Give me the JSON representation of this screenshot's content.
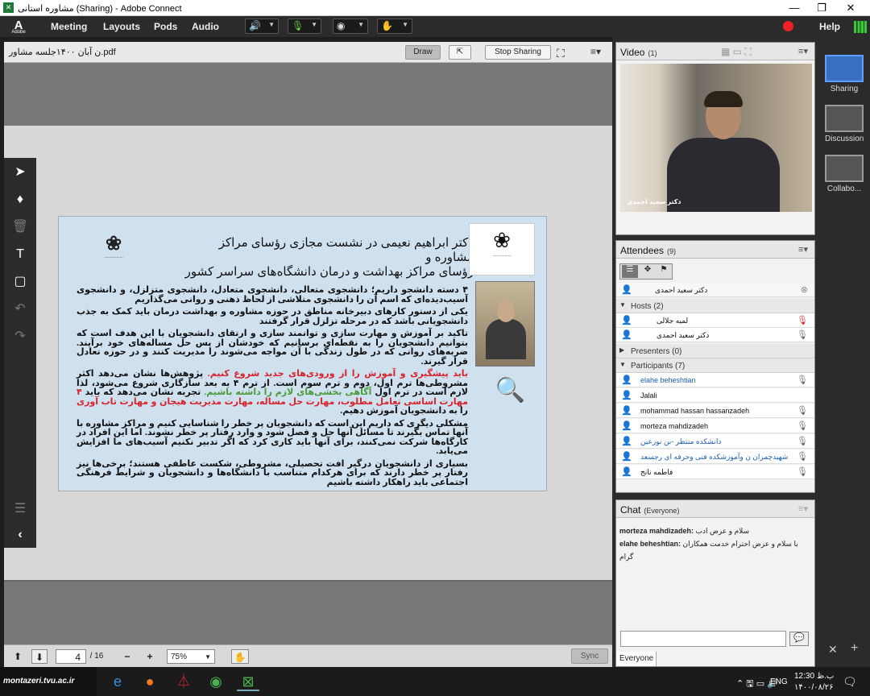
{
  "window": {
    "title": "مشاوره استانی (Sharing) - Adobe Connect",
    "minimize": "—",
    "maximize": "❐",
    "close": "✕"
  },
  "menubar": {
    "logo": "A",
    "logo_sub": "Adobe",
    "items": [
      "Meeting",
      "Layouts",
      "Pods",
      "Audio"
    ],
    "help": "Help"
  },
  "share": {
    "filename": "ن آبان ۱۴۰۰جلسه مشاور.pdf",
    "draw": "Draw",
    "stop": "Stop Sharing",
    "page_current": "4",
    "page_total": "/ 16",
    "zoom": "75%",
    "sync": "Sync"
  },
  "slide": {
    "heading_line1": "دکتر ابراهیم نعیمی در نشست مجازی رؤسای مراکز مشاوره و",
    "heading_line2": "رؤسای مراکز بهداشت و درمان دانشگاه‌های سراسر کشور",
    "p1": "۴ دسته دانشجو داریم؛ دانشجوی متعالی، دانشجوی متعادل، دانشجوی متزلزل، و دانشجوی آسیب‌دیده‌ای که اسم آن را دانشجوی متلاشی از لحاظ ذهنی و روانی می‌گذاریم",
    "p2": "یکی از دستور کارهای دبیرخانه مناطق در حوزه مشاوره و بهداشت درمان باید کمک به جذب دانشجویانی باشد که در مرحله تزلزل قرار گرفتند",
    "p3": "تاکید بر آموزش و مهارت سازی و توانمند سازی و ارتقای دانشجویان با این هدف است که بتوانیم دانشجویان را به نقطه‌ای برسانیم که خودشان از پس حل مساله‌های خود برآیند. ضربه‌های روانی که در طول زندگی با آن مواجه می‌شوند را مدیریت کنند و در حوزه تعادل قرار گیرند.",
    "p4_red": "باید پیشگیری و آموزش را از ورودی‌های جدید شروع کنیم.",
    "p4_a": " پژوهش‌ها نشان می‌دهد اکثر مشروطی‌ها ترم اول، دوم و ترم سوم است. از ترم ۴ به بعد سازگاری شروع می‌شود، لذا لازم است در ترم اول ",
    "p4_green": "آگاهی بخشی‌های لازم را داشته باشیم.",
    "p4_b": " تجربه نشان می‌دهد که باید ",
    "p4_red2": "۴ مهارت اساسی تعامل مطلوب، مهارت حل مساله، مهارت مدیریت هیجان و مهارت تاب آوری",
    "p4_c": " را به دانشجویان آموزش دهیم.",
    "p5": "مشکلی دیگری که داریم این است که دانشجویان پر خطر را شناسایی کنیم و مراکز مشاوره با آنها تماس بگیرند تا مسائل آنها حل و فصل شود و وارد رفتار پر خطر نشوند. اما این افراد در کارگاه‌ها شرکت نمی‌کنند، برای آنها باید کاری کرد که اگر تدبیر نکنیم آسیب‌های ما افزایش می‌یابد.",
    "p6": "بسیاری از دانشجویان درگیر افت تحصیلی، مشروطی، شکست عاطفی هستند؛ برخی‌ها نیز رفتار پر خطر دارند که برای هرکدام متناسب با دانشگاه‌ها و دانشجویان و شرایط فرهنگی اجتماعی باید راهکار داشته باشیم"
  },
  "video": {
    "title": "Video",
    "count": "(1)",
    "caption": "دکتر سعید احمدی"
  },
  "attendees": {
    "title": "Attendees",
    "count": "(9)",
    "me": "دکتر سعید احمدی",
    "hosts_label": "Hosts (2)",
    "hosts": [
      "لمیه جلالی",
      "دکتر سعید احمدی"
    ],
    "presenters_label": "Presenters (0)",
    "participants_label": "Participants (7)",
    "participants": [
      {
        "name": "elahe beheshtian",
        "blue": true
      },
      {
        "name": "Jalali",
        "blue": false
      },
      {
        "name": "mohammad hassan hassanzadeh",
        "blue": false
      },
      {
        "name": "morteza mahdizadeh",
        "blue": false
      },
      {
        "name": "دانشکده منتظر -بن نورعین",
        "blue": true
      },
      {
        "name": "شهیدچمران ن وآموزشکده فنی وحرفه ای رجسعد",
        "blue": true
      },
      {
        "name": "فاطمه نانج",
        "blue": false
      }
    ]
  },
  "chat": {
    "title": "Chat",
    "audience": "(Everyone)",
    "messages": [
      {
        "from": "morteza mahdizadeh:",
        "text": "سلام و عرض ادب"
      },
      {
        "from": "elahe beheshtian:",
        "text": "با سلام و عرض احترام خدمت همکاران گرام"
      }
    ],
    "everyone_tab": "Everyone"
  },
  "layouts": [
    "Sharing",
    "Discussion",
    "Collabo..."
  ],
  "taskbar": {
    "search_text": "montazeri.tvu.ac.ir",
    "lang": "ENG",
    "time": "12:30 ب.ظ",
    "date": "۱۴۰۰/۰۸/۲۶"
  }
}
